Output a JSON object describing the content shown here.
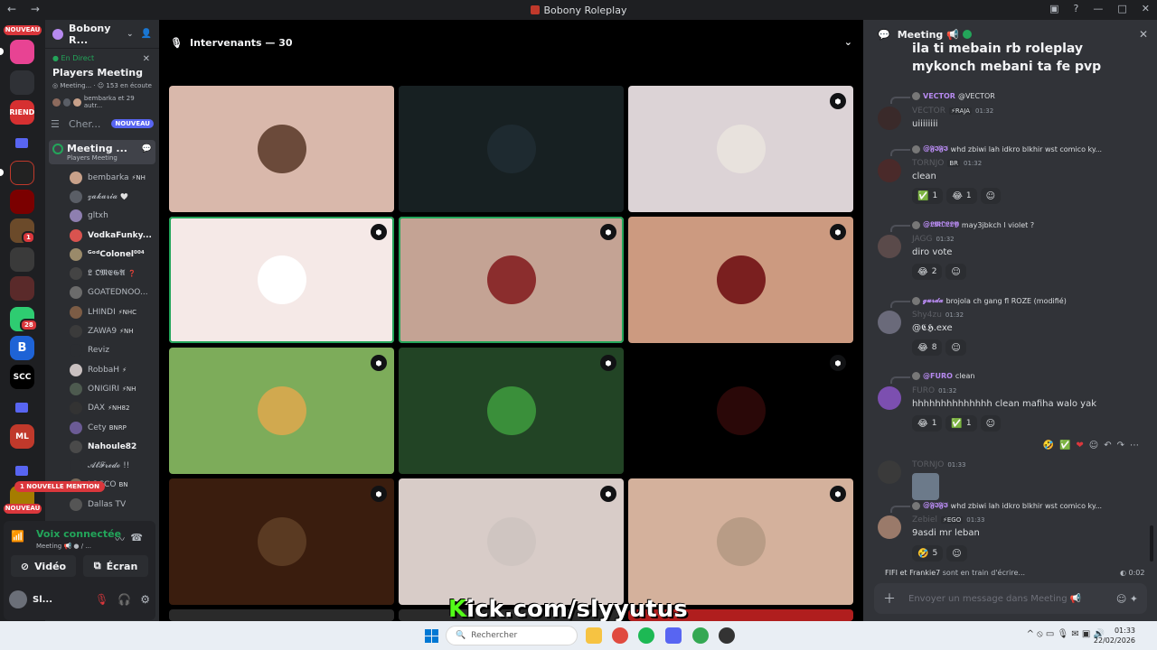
{
  "window": {
    "title": "Bobony Roleplay",
    "nav_icons": "← →",
    "controls": [
      "▣",
      "?",
      "—",
      "□",
      "✕"
    ]
  },
  "servers": {
    "new_badge": "NOUVEAU",
    "bottom_new_badge": "NOUVEAU",
    "badges": [
      "1",
      "28"
    ],
    "labels": [
      "FRIENDS",
      "B",
      "SCC",
      "ML"
    ]
  },
  "guild": {
    "name": "Bobony R...",
    "event": {
      "live_label": "● En Direct",
      "title": "Players Meeting",
      "meta": "◎ Meeting... · ☺ 153 en écoute",
      "attendees": "bembarka et 29 autr...",
      "close": "✕"
    },
    "search_channel": {
      "label": "Cher...",
      "badge": "NOUVEAU"
    },
    "voice_channel": {
      "name": "Meeting ...",
      "subtitle": "Players Meeting"
    },
    "users": [
      {
        "name": "bembarka",
        "tag": "⚡NH",
        "color": "#c8a18a"
      },
      {
        "name": "𝔃𝓪𝓴𝓪𝓻𝓲𝓪",
        "tag": "🤍",
        "color": "#5a5e66"
      },
      {
        "name": "gltxh",
        "tag": "",
        "color": "#8e7fb0"
      },
      {
        "name": "VodkaFunky...",
        "tag": "",
        "color": "#d9534f",
        "bold": true
      },
      {
        "name": "ᴳᵒᵈColonel⁰⁰⁴",
        "tag": "",
        "color": "#9a8a6a",
        "bold": true
      },
      {
        "name": "𝕷 𝕺𝕸𝕰𝕲𝕬",
        "tag": "❓",
        "color": "#444"
      },
      {
        "name": "GOATEDNOO...",
        "tag": "",
        "color": "#6b6b6b"
      },
      {
        "name": "LHINDI",
        "tag": "⚡NHC",
        "color": "#7c5c45"
      },
      {
        "name": "ZAWA9",
        "tag": "⚡NH",
        "color": "#3b3b3b"
      },
      {
        "name": "Reviz",
        "tag": "",
        "color": "#2b2d31"
      },
      {
        "name": "RobbaH",
        "tag": "⚡",
        "color": "#c9c0c0"
      },
      {
        "name": "ONIGIRI",
        "tag": "⚡NH",
        "color": "#4d5a4f"
      },
      {
        "name": "DAX",
        "tag": "⚡NH82",
        "color": "#333"
      },
      {
        "name": "Cety",
        "tag": "BNRP",
        "color": "#6b5b95"
      },
      {
        "name": "Nahoule82",
        "tag": "",
        "color": "#4a4a4a",
        "bold": true
      },
      {
        "name": "𝓐𝓵𝓕𝓻𝓮𝓭𝓸 !!",
        "tag": "",
        "color": "#2b2d31"
      },
      {
        "name": "LOCCO",
        "tag": "BN",
        "color": "#7a6b5a"
      },
      {
        "name": "Dallas TV",
        "tag": "",
        "color": "#555"
      }
    ],
    "mention_banner": "1 NOUVELLE MENTION"
  },
  "voice_panel": {
    "status": "Voix connectée",
    "channel": "Meeting 📢 ● / ...",
    "video_label": "Vidéo",
    "screen_label": "Écran",
    "self_name": "Sl..."
  },
  "main": {
    "header": "Intervenants — 30",
    "tiles": [
      {
        "bg": "#d9b8ab",
        "ava": "#6b4a3a",
        "shield": false,
        "speaking": false
      },
      {
        "bg": "#172022",
        "ava": "#1e2a30",
        "shield": false,
        "speaking": false
      },
      {
        "bg": "#dcd3d6",
        "ava": "#e8e2dd",
        "shield": true,
        "speaking": false
      },
      {
        "bg": "#f5e9e7",
        "ava": "#ffffff",
        "shield": true,
        "speaking": true
      },
      {
        "bg": "#c4a394",
        "ava": "#8b2d2d",
        "shield": true,
        "speaking": true
      },
      {
        "bg": "#cc9a80",
        "ava": "#7a1f1f",
        "shield": true,
        "speaking": false
      },
      {
        "bg": "#7dac5a",
        "ava": "#d1a94f",
        "shield": true,
        "speaking": false
      },
      {
        "bg": "#224425",
        "ava": "#3a8f3a",
        "shield": true,
        "speaking": false
      },
      {
        "bg": "#000000",
        "ava": "#2a0808",
        "shield": true,
        "speaking": false
      },
      {
        "bg": "#3a1d0e",
        "ava": "#5a3a22",
        "shield": true,
        "speaking": false
      },
      {
        "bg": "#d8ccc8",
        "ava": "#cfc5c1",
        "shield": true,
        "speaking": false
      },
      {
        "bg": "#d4b19c",
        "ava": "#b89c86",
        "shield": true,
        "speaking": false
      }
    ],
    "shield_icon": "⬢"
  },
  "overlay_banner": {
    "k": "K",
    "rest": "ick.com/slyyutus"
  },
  "chat": {
    "header": "Meeting 📢",
    "top_message": "ila ti mebain rb roleplay mykonch mebani ta fe pvp",
    "messages": [
      {
        "reply_name": "VECTOR",
        "reply_text": "@VECTOR",
        "name": "VECTOR",
        "rtag": "⚡RAJA",
        "time": "01:32",
        "body": "uiiiiiiii",
        "reactions": [],
        "color": "#3a2a2a"
      },
      {
        "reply_name": "@𝕱𝕴𝕱𝕴",
        "reply_text": "whd zbiwi lah idkro blkhir  wst comico ky...",
        "name": "TORNJO",
        "rtag": "BR",
        "time": "01:32",
        "body": "clean",
        "reactions": [
          {
            "e": "✅",
            "c": "1"
          },
          {
            "e": "😂",
            "c": "1"
          },
          {
            "e": "☺",
            "c": ""
          }
        ],
        "color": "#4a2a2a"
      },
      {
        "reply_name": "@𝕷𝕸𝕺𝕷𝕷𝖄",
        "reply_text": "may3jbkch l violet ?",
        "name": "JAGG",
        "rtag": "",
        "time": "01:32",
        "body": "diro vote",
        "reactions": [
          {
            "e": "😂",
            "c": "2"
          },
          {
            "e": "☺",
            "c": ""
          }
        ],
        "color": "#5a4a4a"
      },
      {
        "reply_name": "𝓰𝓾𝓻𝓭𝓪",
        "reply_text": "brojola ch gang fl ROZE (modifié)",
        "name": "Shy4zu",
        "rtag": "",
        "time": "01:32",
        "body": "@𝕮𝕳.exe",
        "reactions": [
          {
            "e": "😂",
            "c": "8"
          },
          {
            "e": "☺",
            "c": ""
          }
        ],
        "color": "#6a6a7a"
      },
      {
        "reply_name": "@FURO",
        "reply_text": "clean",
        "name": "FURO",
        "rtag": "",
        "time": "01:32",
        "body": "hhhhhhhhhhhhhh clean mafiha walo yak",
        "reactions": [
          {
            "e": "😂",
            "c": "1"
          },
          {
            "e": "✅",
            "c": "1"
          },
          {
            "e": "☺",
            "c": ""
          }
        ],
        "color": "#7c4fb0"
      },
      {
        "reply_name": "",
        "reply_text": "",
        "name": "TORNJO",
        "rtag": "",
        "time": "01:33",
        "body": "",
        "reactions": [],
        "color": "#3a3a3a"
      },
      {
        "reply_name": "@𝕱𝕴𝕱𝕴",
        "reply_text": "whd zbiwi lah idkro blkhir  wst comico ky...",
        "name": "Zebiel",
        "rtag": "⚡EGO",
        "time": "01:33",
        "body": "9asdi mr leban",
        "reactions": [
          {
            "e": "🤣",
            "c": "5"
          },
          {
            "e": "☺",
            "c": ""
          }
        ],
        "color": "#9a7a6a"
      }
    ],
    "hover_tools": [
      "🤣",
      "✅",
      "❤",
      "☺",
      "↶",
      "↷",
      "⋯"
    ],
    "typing": "FIFI et Frankie7",
    "typing_suffix": " sont en train d'écrire...",
    "typing_time": "◐ 0:02",
    "composer_placeholder": "Envoyer un message dans Meeting 📢",
    "composer_icons": "☺ ✦"
  },
  "taskbar": {
    "search_placeholder": "Rechercher",
    "time": "01:33",
    "date": "22/02/2026",
    "tray": "^ ⦸ ▭ 🎙 ✉ ▣ 🔊"
  }
}
